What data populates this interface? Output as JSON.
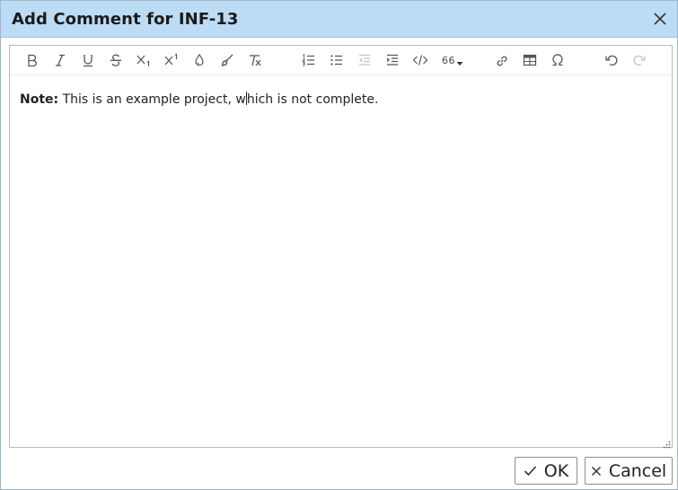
{
  "dialog": {
    "title": "Add Comment for INF-13",
    "close_icon": "close-icon"
  },
  "toolbar": {
    "buttons": [
      {
        "name": "bold-button",
        "icon": "bold-icon"
      },
      {
        "name": "italic-button",
        "icon": "italic-icon"
      },
      {
        "name": "underline-button",
        "icon": "underline-icon"
      },
      {
        "name": "strikethrough-button",
        "icon": "strikethrough-icon"
      },
      {
        "name": "subscript-button",
        "icon": "subscript-icon"
      },
      {
        "name": "superscript-button",
        "icon": "superscript-icon"
      },
      {
        "name": "text-color-button",
        "icon": "droplet-icon"
      },
      {
        "name": "highlight-button",
        "icon": "brush-icon"
      },
      {
        "name": "clear-format-button",
        "icon": "clear-format-icon"
      },
      {
        "name": "numbered-list-button",
        "icon": "ordered-list-icon"
      },
      {
        "name": "bullet-list-button",
        "icon": "unordered-list-icon"
      },
      {
        "name": "outdent-button",
        "icon": "outdent-icon",
        "disabled": true
      },
      {
        "name": "indent-button",
        "icon": "indent-icon"
      },
      {
        "name": "code-button",
        "icon": "code-icon"
      },
      {
        "name": "quote-button",
        "icon": "quote-icon"
      },
      {
        "name": "link-button",
        "icon": "link-icon"
      },
      {
        "name": "table-button",
        "icon": "table-icon"
      },
      {
        "name": "special-char-button",
        "icon": "omega-icon"
      },
      {
        "name": "undo-button",
        "icon": "undo-icon"
      },
      {
        "name": "redo-button",
        "icon": "redo-icon",
        "disabled": true
      }
    ],
    "quote_label": "66"
  },
  "editor": {
    "note_label": "Note:",
    "text_before_caret": " This is an example project, w",
    "text_after_caret": "hich is not complete."
  },
  "footer": {
    "ok_label": "OK",
    "cancel_label": "Cancel"
  },
  "colors": {
    "titlebar": "#bcdcf5",
    "border": "#b9b9b9"
  }
}
